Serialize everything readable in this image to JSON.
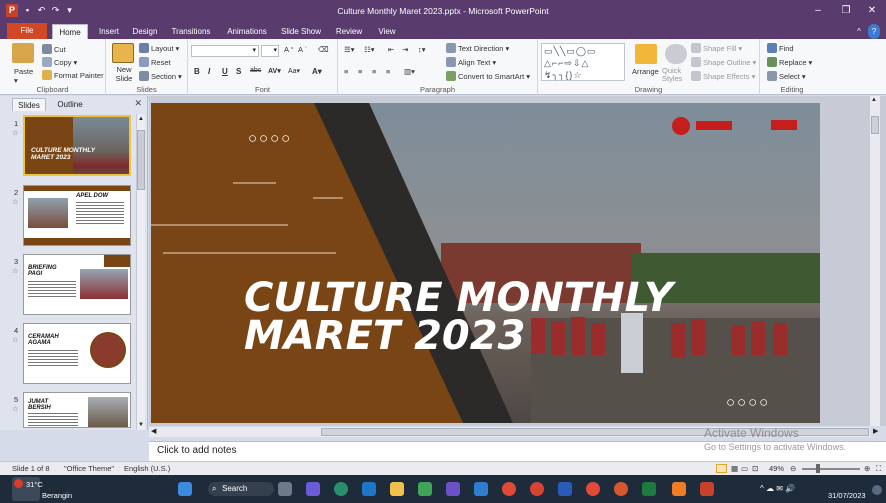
{
  "window": {
    "title": "Culture Monthly Maret 2023.pptx - Microsoft PowerPoint"
  },
  "ribbon_tabs": [
    "File",
    "Home",
    "Insert",
    "Design",
    "Transitions",
    "Animations",
    "Slide Show",
    "Review",
    "View"
  ],
  "ribbon": {
    "clipboard": {
      "label": "Clipboard",
      "paste": "Paste",
      "cut": "Cut",
      "copy": "Copy",
      "format_painter": "Format Painter"
    },
    "slides": {
      "label": "Slides",
      "new_slide": "New Slide",
      "layout": "Layout",
      "reset": "Reset",
      "section": "Section"
    },
    "font": {
      "label": "Font"
    },
    "paragraph": {
      "label": "Paragraph",
      "text_direction": "Text Direction",
      "align_text": "Align Text",
      "convert_smartart": "Convert to SmartArt"
    },
    "drawing": {
      "label": "Drawing",
      "arrange": "Arrange",
      "quick_styles": "Quick Styles",
      "shape_fill": "Shape Fill",
      "shape_outline": "Shape Outline",
      "shape_effects": "Shape Effects"
    },
    "editing": {
      "label": "Editing",
      "find": "Find",
      "replace": "Replace",
      "select": "Select"
    }
  },
  "left_panel": {
    "tabs": [
      "Slides",
      "Outline"
    ],
    "thumbnails": [
      {
        "num": "1",
        "title": "CULTURE MONTHLY MARET 2023"
      },
      {
        "num": "2",
        "title": "APEL DOW"
      },
      {
        "num": "3",
        "title": "BRIEFING PAGI"
      },
      {
        "num": "4",
        "title": "CERAMAH AGAMA"
      },
      {
        "num": "5",
        "title": "JUMAT BERSIH"
      }
    ]
  },
  "slide": {
    "title_line1": "CULTURE MONTHLY",
    "title_line2": "MARET 2023",
    "dots": "○○○○"
  },
  "notes_placeholder": "Click to add notes",
  "watermark": {
    "line1": "Activate Windows",
    "line2": "Go to Settings to activate Windows."
  },
  "status": {
    "slide_info": "Slide 1 of 8",
    "theme": "\"Office Theme\"",
    "language": "English (U.S.)",
    "zoom": "49%"
  },
  "taskbar": {
    "weather_temp": "31°C",
    "weather_desc": "Berangin",
    "search": "Search",
    "date": "31/07/2023"
  },
  "colors": {
    "title_bar": "#5a3b6e",
    "file_tab": "#d24726",
    "slide_brown": "#7a4514"
  }
}
